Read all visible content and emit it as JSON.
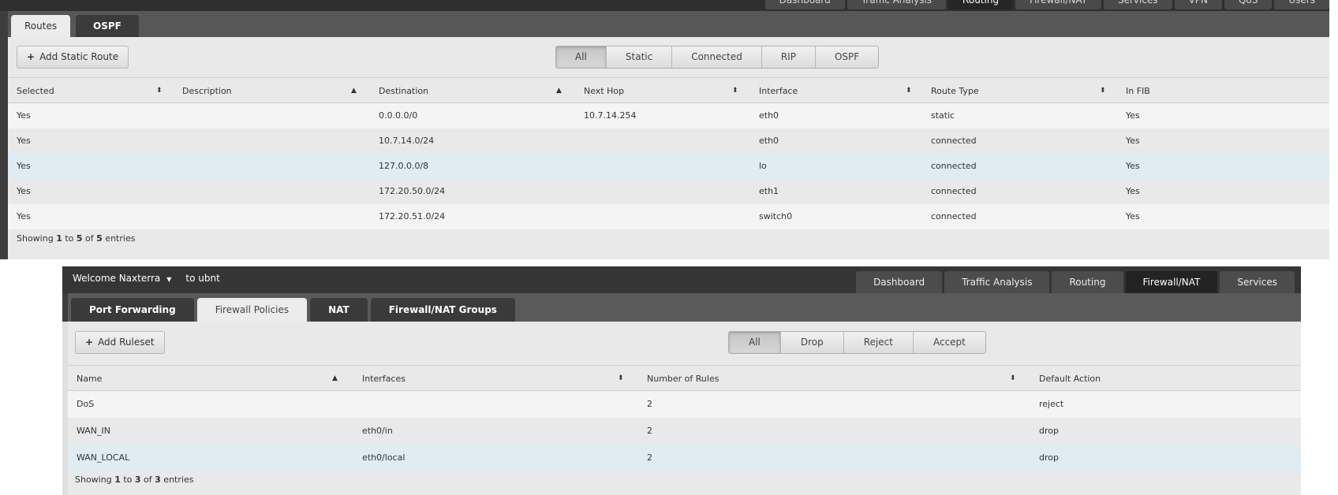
{
  "routing": {
    "top_nav": [
      {
        "label": "Dashboard",
        "active": false
      },
      {
        "label": "Traffic Analysis",
        "active": false
      },
      {
        "label": "Routing",
        "active": true
      },
      {
        "label": "Firewall/NAT",
        "active": false
      },
      {
        "label": "Services",
        "active": false
      },
      {
        "label": "VPN",
        "active": false
      },
      {
        "label": "QoS",
        "active": false
      },
      {
        "label": "Users",
        "active": false
      }
    ],
    "tabs": [
      {
        "label": "Routes",
        "active": true
      },
      {
        "label": "OSPF",
        "active": false
      }
    ],
    "add_button": {
      "icon": "plus-icon",
      "label": "Add Static Route"
    },
    "filters": [
      {
        "label": "All",
        "active": true
      },
      {
        "label": "Static",
        "active": false
      },
      {
        "label": "Connected",
        "active": false
      },
      {
        "label": "RIP",
        "active": false
      },
      {
        "label": "OSPF",
        "active": false
      }
    ],
    "columns": [
      {
        "label": "Selected",
        "sort": "both"
      },
      {
        "label": "Description",
        "sort": "asc"
      },
      {
        "label": "Destination",
        "sort": "asc"
      },
      {
        "label": "Next Hop",
        "sort": "both"
      },
      {
        "label": "Interface",
        "sort": "both"
      },
      {
        "label": "Route Type",
        "sort": "both"
      },
      {
        "label": "In FIB",
        "sort": "none"
      }
    ],
    "rows": [
      {
        "selected": "Yes",
        "description": "",
        "destination": "0.0.0.0/0",
        "next_hop": "10.7.14.254",
        "interface": "eth0",
        "route_type": "static",
        "in_fib": "Yes",
        "highlight": false
      },
      {
        "selected": "Yes",
        "description": "",
        "destination": "10.7.14.0/24",
        "next_hop": "",
        "interface": "eth0",
        "route_type": "connected",
        "in_fib": "Yes",
        "highlight": false
      },
      {
        "selected": "Yes",
        "description": "",
        "destination": "127.0.0.0/8",
        "next_hop": "",
        "interface": "lo",
        "route_type": "connected",
        "in_fib": "Yes",
        "highlight": true
      },
      {
        "selected": "Yes",
        "description": "",
        "destination": "172.20.50.0/24",
        "next_hop": "",
        "interface": "eth1",
        "route_type": "connected",
        "in_fib": "Yes",
        "highlight": false
      },
      {
        "selected": "Yes",
        "description": "",
        "destination": "172.20.51.0/24",
        "next_hop": "",
        "interface": "switch0",
        "route_type": "connected",
        "in_fib": "Yes",
        "highlight": false
      }
    ],
    "footer": {
      "prefix": "Showing ",
      "from": "1",
      "to_word": " to ",
      "to": "5",
      "of_word": " of ",
      "total": "5",
      "suffix": " entries"
    }
  },
  "firewall": {
    "welcome": {
      "text": "Welcome Naxterra",
      "caret": "▼",
      "host": "to ubnt"
    },
    "main_nav": [
      {
        "label": "Dashboard",
        "active": false
      },
      {
        "label": "Traffic Analysis",
        "active": false
      },
      {
        "label": "Routing",
        "active": false
      },
      {
        "label": "Firewall/NAT",
        "active": true
      },
      {
        "label": "Services",
        "active": false
      }
    ],
    "tabs": [
      {
        "label": "Port Forwarding",
        "active": false
      },
      {
        "label": "Firewall Policies",
        "active": true
      },
      {
        "label": "NAT",
        "active": false
      },
      {
        "label": "Firewall/NAT Groups",
        "active": false
      }
    ],
    "add_button": {
      "icon": "plus-icon",
      "label": "Add Ruleset"
    },
    "filters": [
      {
        "label": "All",
        "active": true
      },
      {
        "label": "Drop",
        "active": false
      },
      {
        "label": "Reject",
        "active": false
      },
      {
        "label": "Accept",
        "active": false
      }
    ],
    "columns": [
      {
        "label": "Name",
        "sort": "asc"
      },
      {
        "label": "Interfaces",
        "sort": "both"
      },
      {
        "label": "Number of Rules",
        "sort": "both"
      },
      {
        "label": "Default Action",
        "sort": "none"
      }
    ],
    "rows": [
      {
        "name": "DoS",
        "interfaces": "",
        "rules": "2",
        "action": "reject",
        "highlight": false
      },
      {
        "name": "WAN_IN",
        "interfaces": "eth0/in",
        "rules": "2",
        "action": "drop",
        "highlight": false
      },
      {
        "name": "WAN_LOCAL",
        "interfaces": "eth0/local",
        "rules": "2",
        "action": "drop",
        "highlight": true
      }
    ],
    "footer": {
      "prefix": "Showing ",
      "from": "1",
      "to_word": " to ",
      "to": "3",
      "of_word": " of ",
      "total": "3",
      "suffix": " entries"
    }
  },
  "colors": {
    "row_highlight": "#dfecf2",
    "row_stripe": "#f4f4f4",
    "content_bg": "#e9e9e9",
    "dark_bar": "#353535"
  },
  "sort_glyphs": {
    "both": "⬍",
    "asc": "▲"
  }
}
